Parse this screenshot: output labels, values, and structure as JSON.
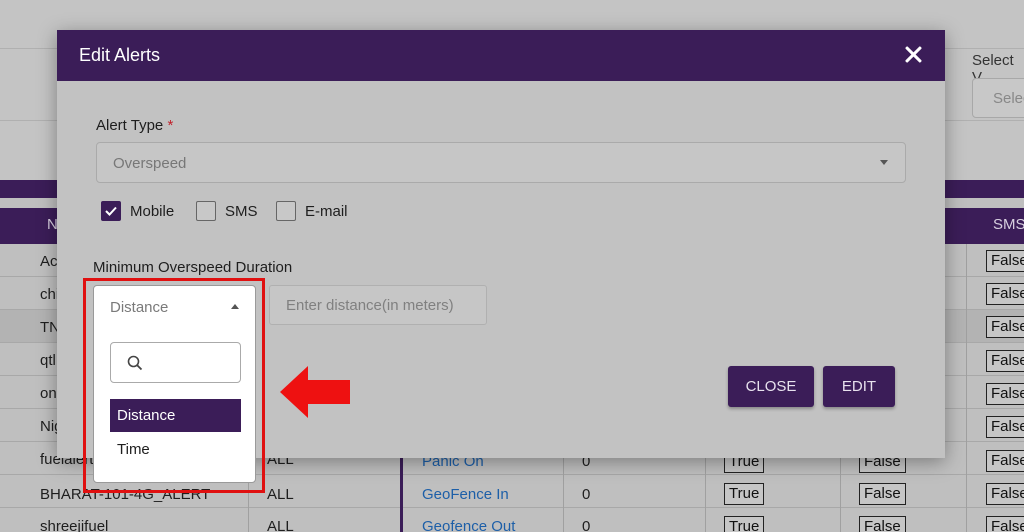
{
  "background": {
    "select_label": "Select V",
    "select_placeholder": "Selec",
    "columns": [
      "N",
      "SMS"
    ],
    "rows": [
      {
        "name": "Ac",
        "sms": "False"
      },
      {
        "name": "chi",
        "sms": "False"
      },
      {
        "name": "TN",
        "sms": "False"
      },
      {
        "name": "qtl",
        "sms": "False"
      },
      {
        "name": "on",
        "sms": "False"
      },
      {
        "name": "Nig",
        "sms": "False"
      },
      {
        "name": "fuelalert",
        "user": "ALL",
        "alert": "Panic On",
        "count": "0",
        "mobile": "True",
        "email": "False",
        "sms": "False"
      },
      {
        "name": "BHARAT-101-4G_ALERT",
        "user": "ALL",
        "alert": "GeoFence In",
        "count": "0",
        "mobile": "True",
        "email": "False",
        "sms": "False"
      },
      {
        "name": "shreejifuel",
        "user": "ALL",
        "alert": "Geofence Out",
        "count": "0",
        "mobile": "True",
        "email": "False",
        "sms": "False"
      }
    ]
  },
  "modal": {
    "title": "Edit Alerts",
    "alert_type_label": "Alert Type",
    "required_mark": "*",
    "alert_type_value": "Overspeed",
    "channels": [
      {
        "label": "Mobile",
        "checked": true
      },
      {
        "label": "SMS",
        "checked": false
      },
      {
        "label": "E-mail",
        "checked": false
      }
    ],
    "duration_label": "Minimum Overspeed Duration",
    "distance_placeholder": "Enter distance(in meters)",
    "close_button": "CLOSE",
    "edit_button": "EDIT"
  },
  "dropdown": {
    "selected": "Distance",
    "search_placeholder": "",
    "options": [
      {
        "label": "Distance",
        "selected": true
      },
      {
        "label": "Time",
        "selected": false
      }
    ]
  },
  "colors": {
    "primary": "#3b1d58",
    "highlight": "#e01010",
    "required": "#c0202a"
  },
  "icons": [
    "close-icon",
    "caret-down-icon",
    "caret-up-icon",
    "checkmark-icon",
    "search-icon",
    "arrow-left-icon"
  ]
}
